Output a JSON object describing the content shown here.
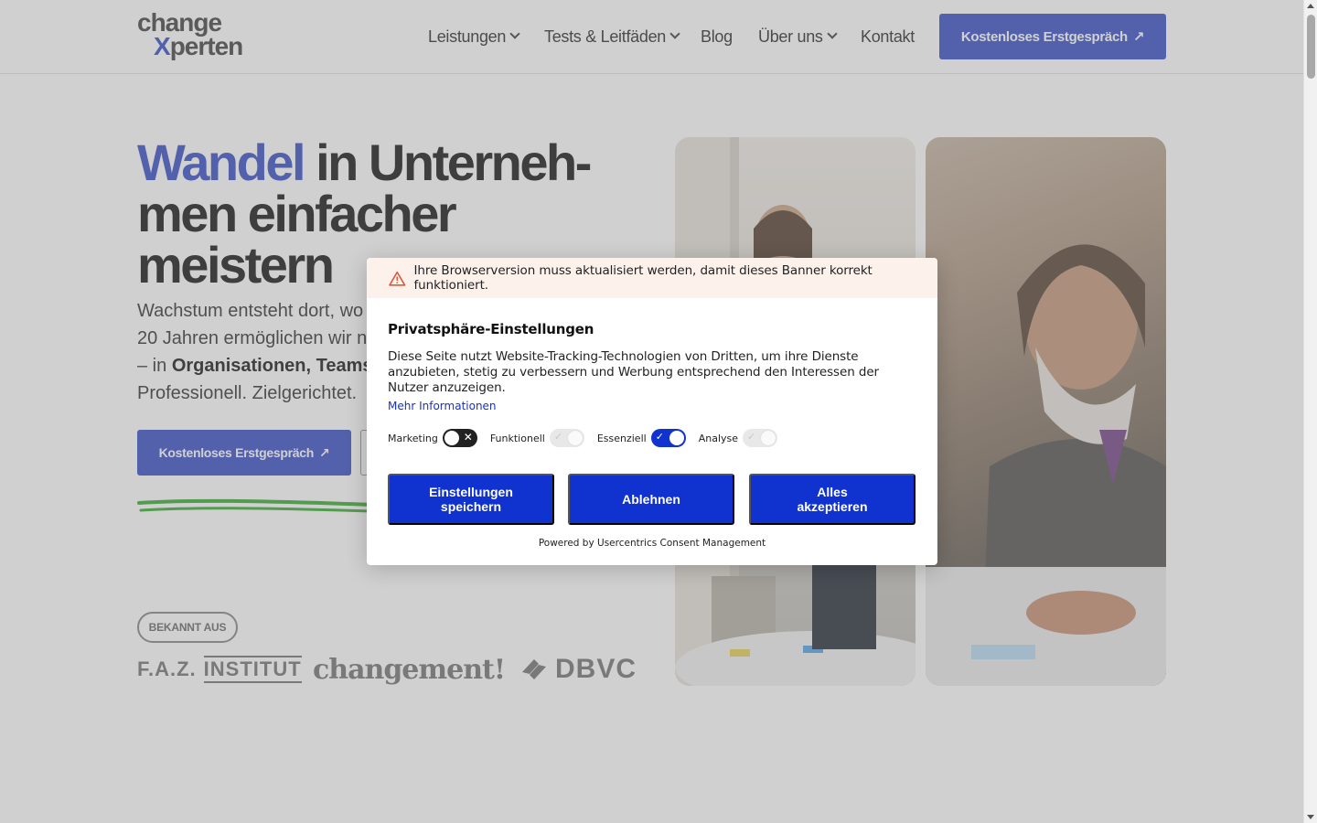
{
  "header": {
    "logo_line1": "change",
    "logo_x": "X",
    "logo_line2_rest": "perten",
    "nav": [
      {
        "label": "Leistungen",
        "dropdown": true
      },
      {
        "label": "Tests & Leitfäden",
        "dropdown": true
      },
      {
        "label": "Blog",
        "dropdown": false
      },
      {
        "label": "Über uns",
        "dropdown": true
      },
      {
        "label": "Kontakt",
        "dropdown": false
      }
    ],
    "cta_label": "Kostenloses Erstgespräch",
    "cta_icon": "↗"
  },
  "hero": {
    "headline_accent": "Wandel",
    "headline_rest": " in Unterneh-men einfacher meistern",
    "lead_visible_1": "Wachstum entsteht dort, wo",
    "lead_visible_2": "20 Jahren ermöglichen wir na",
    "lead_visible_3a": "– in ",
    "lead_visible_3b": "Organisationen, Teams",
    "lead_visible_4": "Professionell. Zielgerichtet.",
    "cta_label": "Kostenloses Erstgespräch",
    "cta_icon": "↗",
    "known_label": "BEKANNT AUS",
    "press": {
      "faz": "F.A.Z.",
      "institut": "INSTITUT",
      "changement": "changement!",
      "dbvc": "DBVC"
    }
  },
  "consent": {
    "warning": "Ihre Browserversion muss aktualisiert werden, damit dieses Banner korrekt funktioniert.",
    "title": "Privatsphäre-Einstellungen",
    "text": "Diese Seite nutzt Website-Tracking-Technologien von Dritten, um ihre Dienste anzubieten, stetig zu verbessern und Werbung entsprechend den Interessen der Nutzer anzuzeigen.",
    "more_link": "Mehr Informationen",
    "toggles": [
      {
        "label": "Marketing",
        "state": "off"
      },
      {
        "label": "Funktionell",
        "state": "disabled"
      },
      {
        "label": "Essenziell",
        "state": "on"
      },
      {
        "label": "Analyse",
        "state": "disabled"
      }
    ],
    "buttons": {
      "save": "Einstellungen speichern",
      "deny": "Ablehnen",
      "accept": "Alles akzeptieren"
    },
    "powered_by": "Powered by Usercentrics Consent Management"
  },
  "colors": {
    "brand_blue": "#3f55c8",
    "consent_blue": "#1032cf",
    "warning_bg": "#fdf1ec",
    "warning_icon": "#e0583a"
  }
}
